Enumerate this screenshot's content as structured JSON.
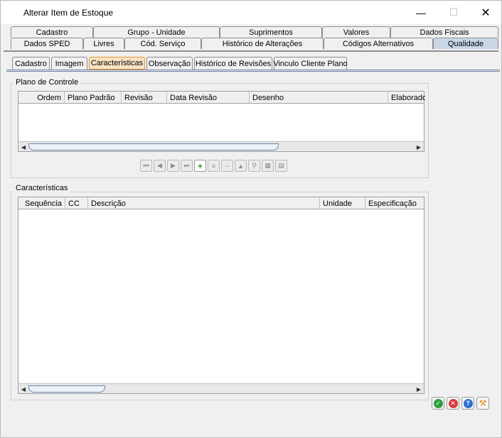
{
  "window": {
    "title": "Alterar Item de Estoque",
    "minimize": "—",
    "maximize": "☐",
    "close": "✕"
  },
  "top_tabs": {
    "row1": [
      "Cadastro",
      "Grupo - Unidade",
      "Suprimentos",
      "Valores",
      "Dados Fiscais"
    ],
    "row2": [
      "Dados SPED",
      "Livres",
      "Cód. Serviço",
      "Histórico de Alterações",
      "Códigos Alternativos",
      "Qualidade"
    ],
    "active": "Qualidade"
  },
  "sub_tabs": {
    "items": [
      "Cadastro",
      "Imagem",
      "Características",
      "Observação",
      "Histórico de Revisões",
      "Vinculo Cliente Plano"
    ],
    "active": "Características"
  },
  "plano_de_controle": {
    "title": "Plano de Controle",
    "columns": [
      "Ordem",
      "Plano Padrão",
      "Revisão",
      "Data Revisão",
      "Desenho",
      "Elaborado"
    ]
  },
  "caracteristicas": {
    "title": "Características",
    "columns": [
      "Sequência",
      "CC",
      "Descrição",
      "Unidade",
      "Especificação"
    ]
  },
  "navigator": {
    "buttons": [
      "first-icon",
      "prior-icon",
      "next-icon",
      "last-icon",
      "insert-icon",
      "delete-icon",
      "cancel-icon",
      "refresh-icon",
      "search-icon",
      "grid-icon",
      "export-icon"
    ]
  },
  "actions": {
    "buttons": [
      "confirm-icon",
      "cancel-icon",
      "help-icon",
      "tools-icon"
    ],
    "colors": {
      "confirm": "#2e9e3e",
      "cancel": "#d83a3a",
      "help": "#2f6fd1",
      "tools": "#e08a1e"
    }
  }
}
